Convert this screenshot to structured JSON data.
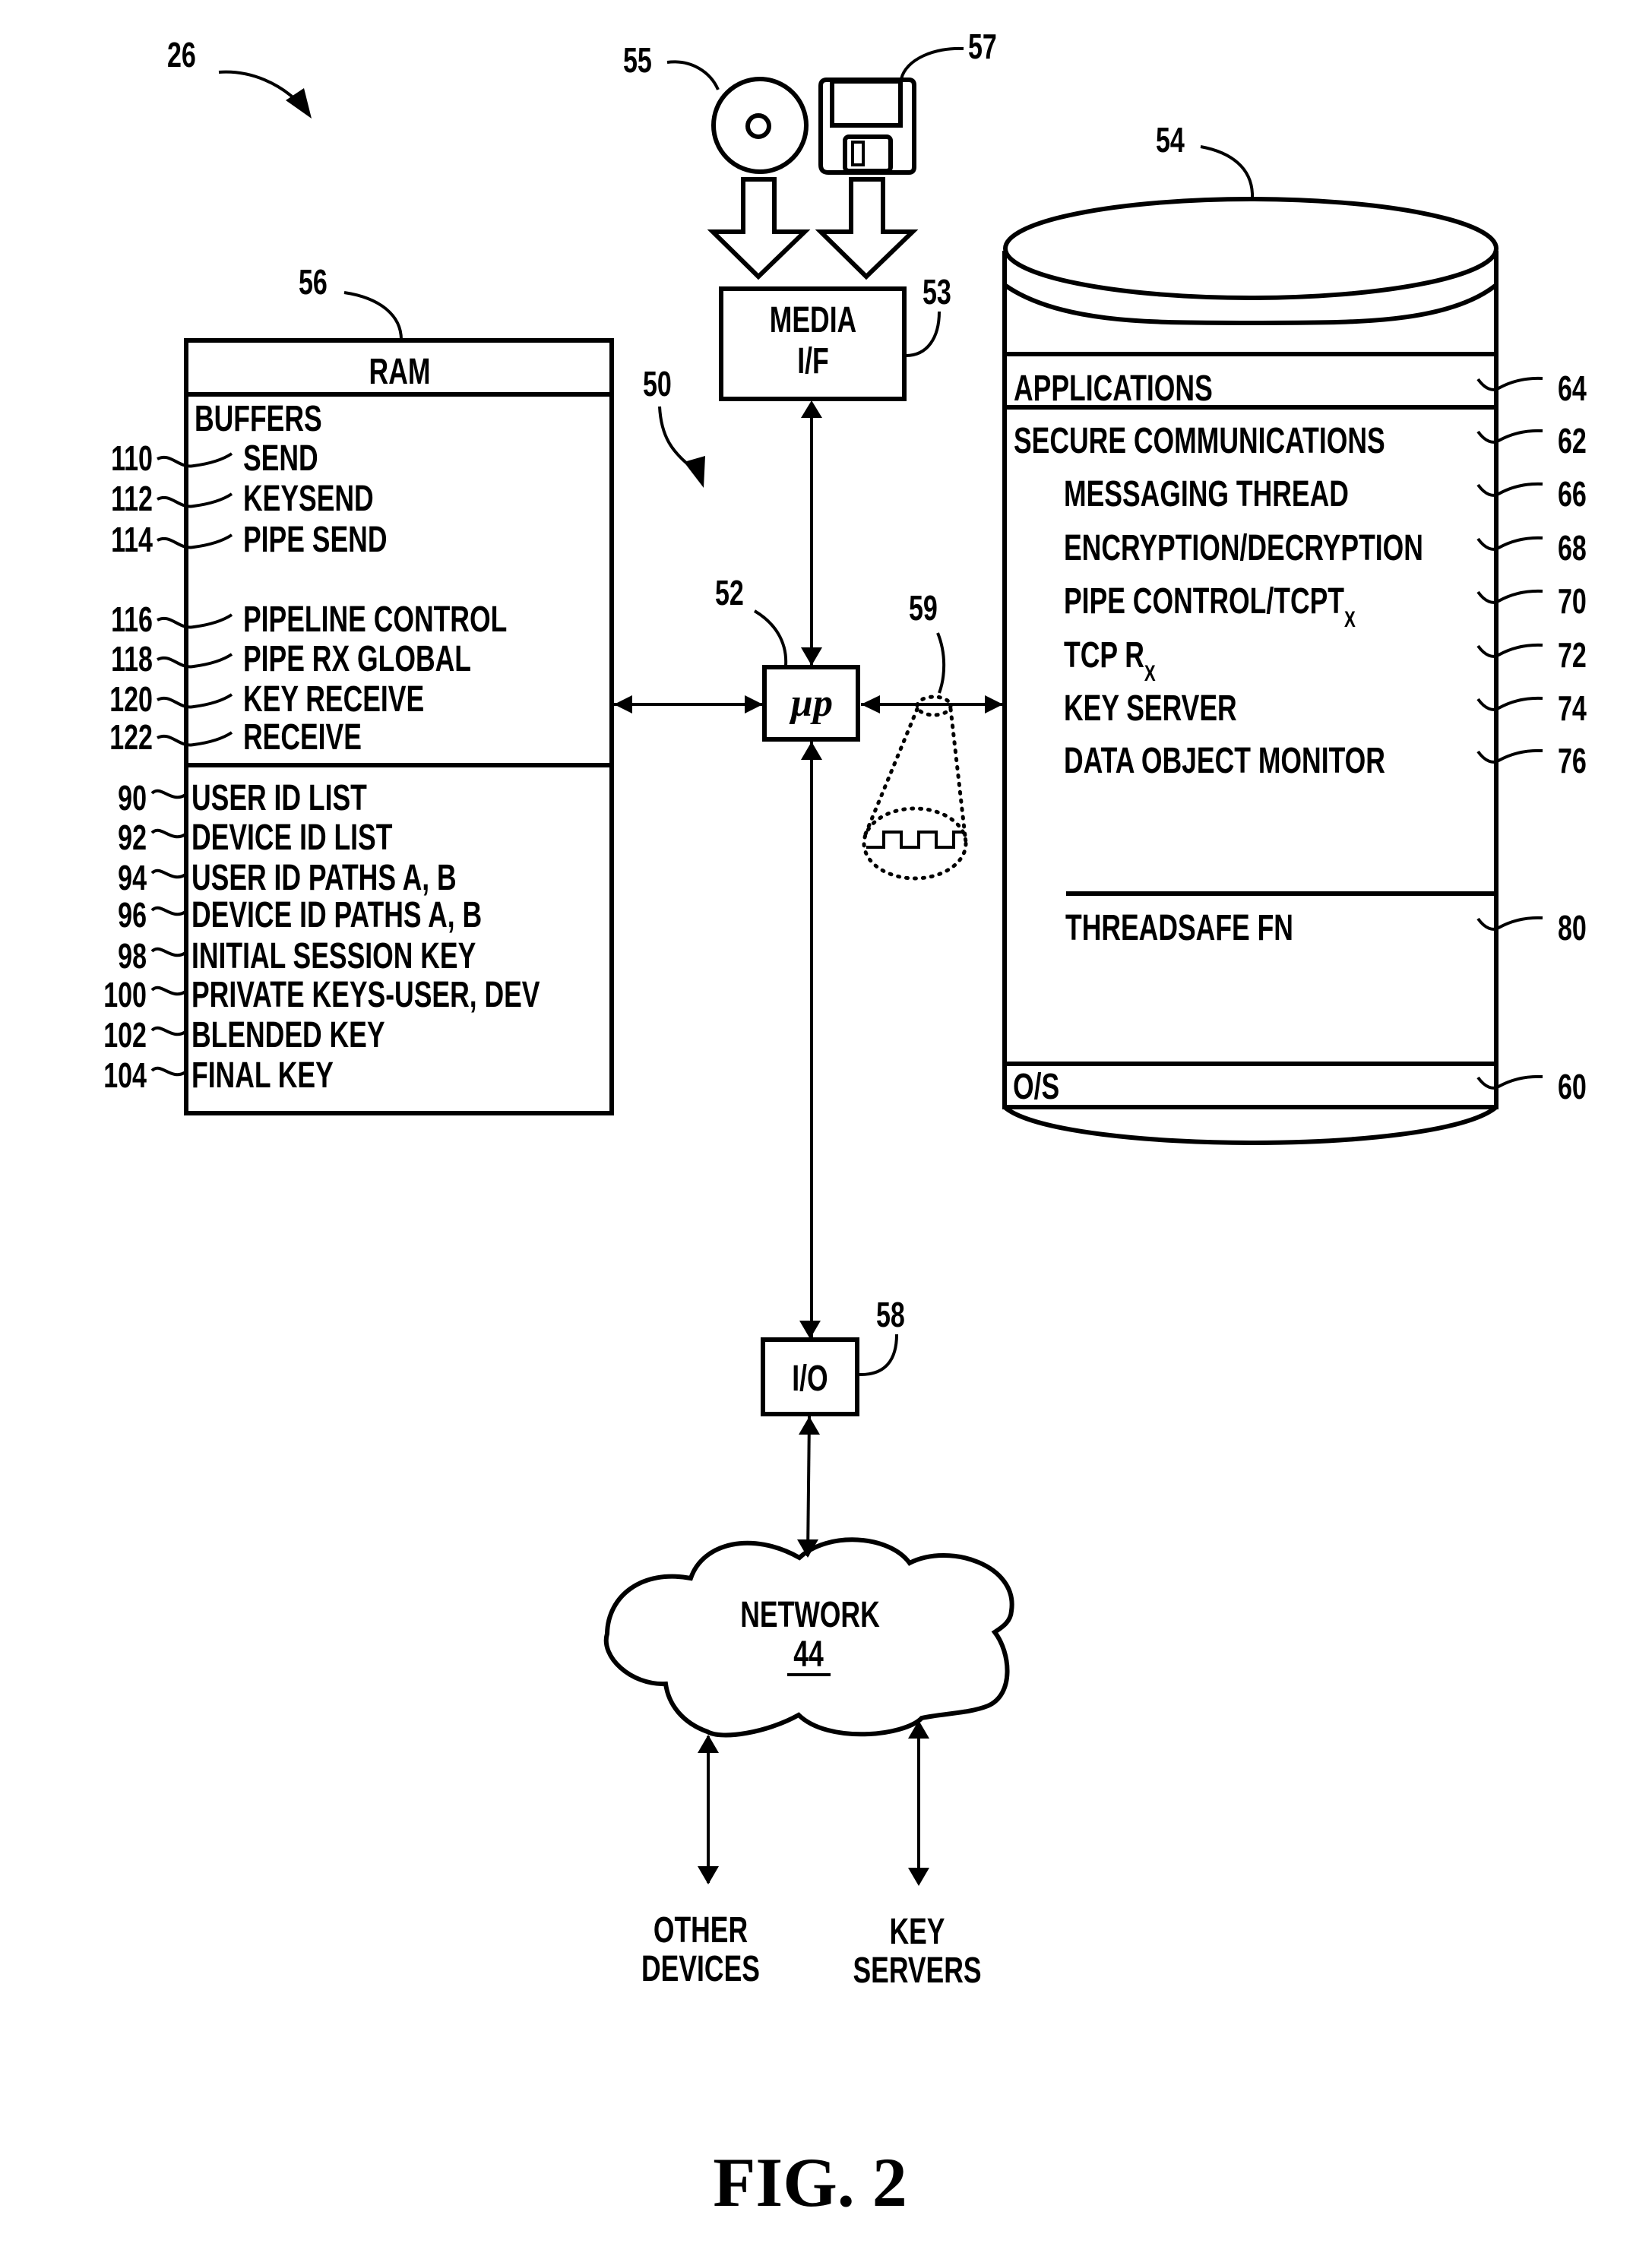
{
  "figure": {
    "title": "FIG. 2",
    "ref_system": "26",
    "ref_bus": "50"
  },
  "ram": {
    "ref": "56",
    "title": "RAM",
    "buffers_heading": "BUFFERS",
    "buffers": [
      {
        "ref": "110",
        "label": "SEND"
      },
      {
        "ref": "112",
        "label": "KEYSEND"
      },
      {
        "ref": "114",
        "label": "PIPE SEND"
      },
      {
        "ref": "116",
        "label": "PIPELINE CONTROL"
      },
      {
        "ref": "118",
        "label": "PIPE RX GLOBAL"
      },
      {
        "ref": "120",
        "label": "KEY RECEIVE"
      },
      {
        "ref": "122",
        "label": "RECEIVE"
      }
    ],
    "data": [
      {
        "ref": "90",
        "label": "USER ID LIST"
      },
      {
        "ref": "92",
        "label": "DEVICE ID LIST"
      },
      {
        "ref": "94",
        "label": "USER ID PATHS A, B"
      },
      {
        "ref": "96",
        "label": "DEVICE ID PATHS A, B"
      },
      {
        "ref": "98",
        "label": "INITIAL SESSION KEY"
      },
      {
        "ref": "100",
        "label": "PRIVATE KEYS-USER, DEV"
      },
      {
        "ref": "102",
        "label": "BLENDED KEY"
      },
      {
        "ref": "104",
        "label": "FINAL KEY"
      }
    ]
  },
  "media": {
    "disc_ref": "55",
    "floppy_ref": "57",
    "interface_ref": "53",
    "interface_line1": "MEDIA",
    "interface_line2": "I/F"
  },
  "processor": {
    "ref": "52",
    "label": "µp"
  },
  "signal": {
    "ref": "59"
  },
  "io": {
    "ref": "58",
    "label": "I/O"
  },
  "storage": {
    "ref": "54",
    "applications": {
      "ref": "64",
      "label": "APPLICATIONS"
    },
    "secure_comms": {
      "ref": "62",
      "label": "SECURE COMMUNICATIONS"
    },
    "modules": [
      {
        "ref": "66",
        "label": "MESSAGING THREAD",
        "sub": ""
      },
      {
        "ref": "68",
        "label": "ENCRYPTION/DECRYPTION",
        "sub": ""
      },
      {
        "ref": "70",
        "label": "PIPE CONTROL/TCPT",
        "sub": "X"
      },
      {
        "ref": "72",
        "label": "TCP R",
        "sub": "X"
      },
      {
        "ref": "74",
        "label": "KEY SERVER",
        "sub": ""
      },
      {
        "ref": "76",
        "label": "DATA OBJECT MONITOR",
        "sub": ""
      }
    ],
    "threadsafe": {
      "ref": "80",
      "label": "THREADSAFE FN"
    },
    "os": {
      "ref": "60",
      "label": "O/S"
    }
  },
  "network": {
    "label": "NETWORK",
    "ref": "44",
    "endpoints": [
      {
        "line1": "OTHER",
        "line2": "DEVICES"
      },
      {
        "line1": "KEY",
        "line2": "SERVERS"
      }
    ]
  }
}
